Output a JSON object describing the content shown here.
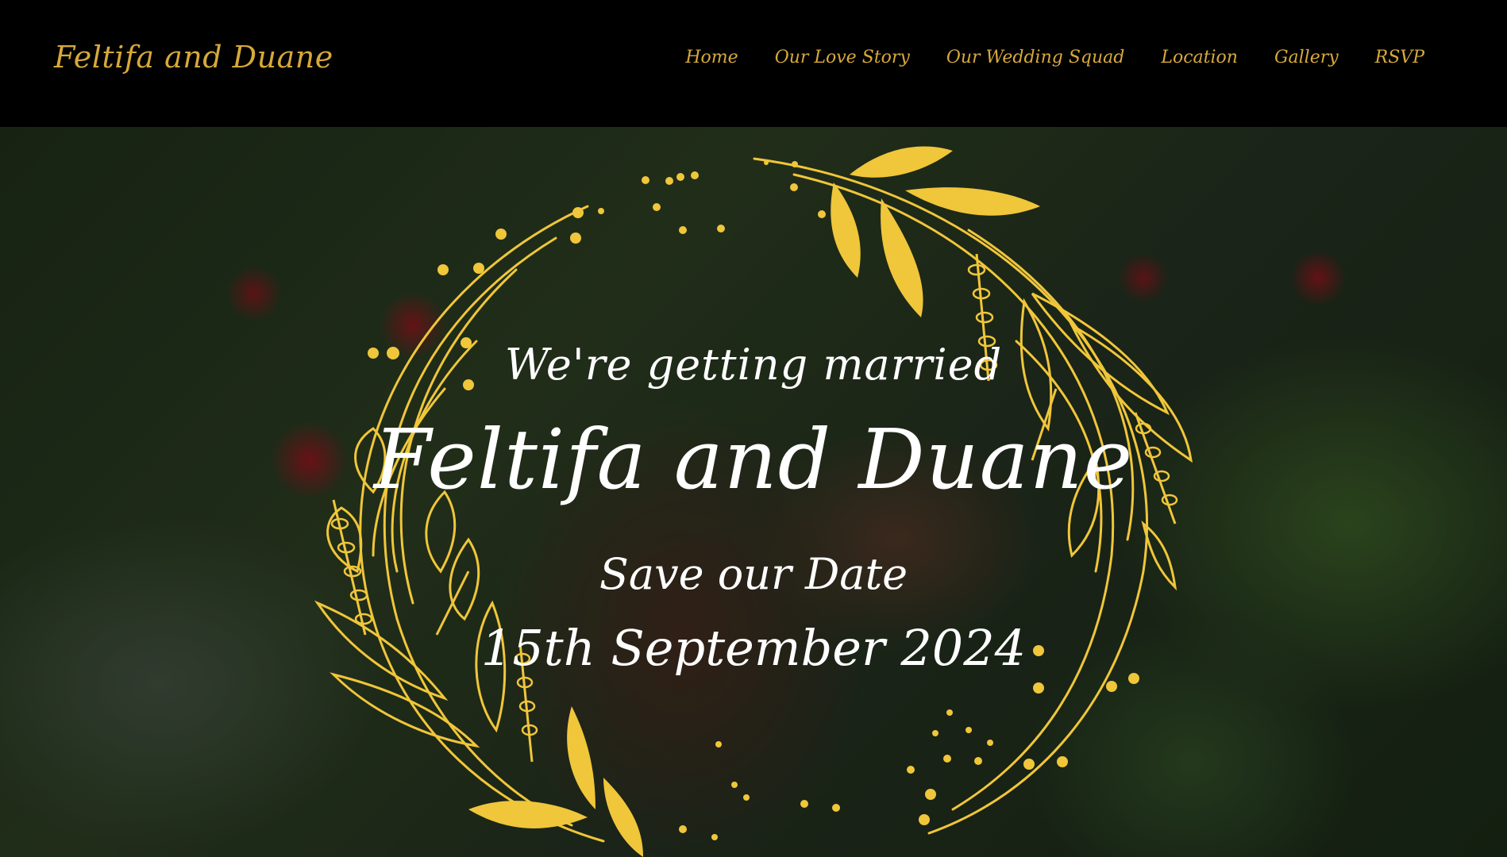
{
  "header": {
    "brand": "Feltifa and Duane",
    "nav": [
      "Home",
      "Our Love Story",
      "Our Wedding Squad",
      "Location",
      "Gallery",
      "RSVP"
    ]
  },
  "hero": {
    "tagline": "We're getting married",
    "couple": "Feltifa and Duane",
    "save_label": "Save our Date",
    "date": "15th September 2024"
  },
  "colors": {
    "accent_gold": "#d7a93a",
    "wreath_gold": "#f0c63a",
    "text": "#ffffff",
    "header_bg": "#000000"
  },
  "icons": [
    "wreath-ornament-icon",
    "flower-ornament-icon"
  ]
}
